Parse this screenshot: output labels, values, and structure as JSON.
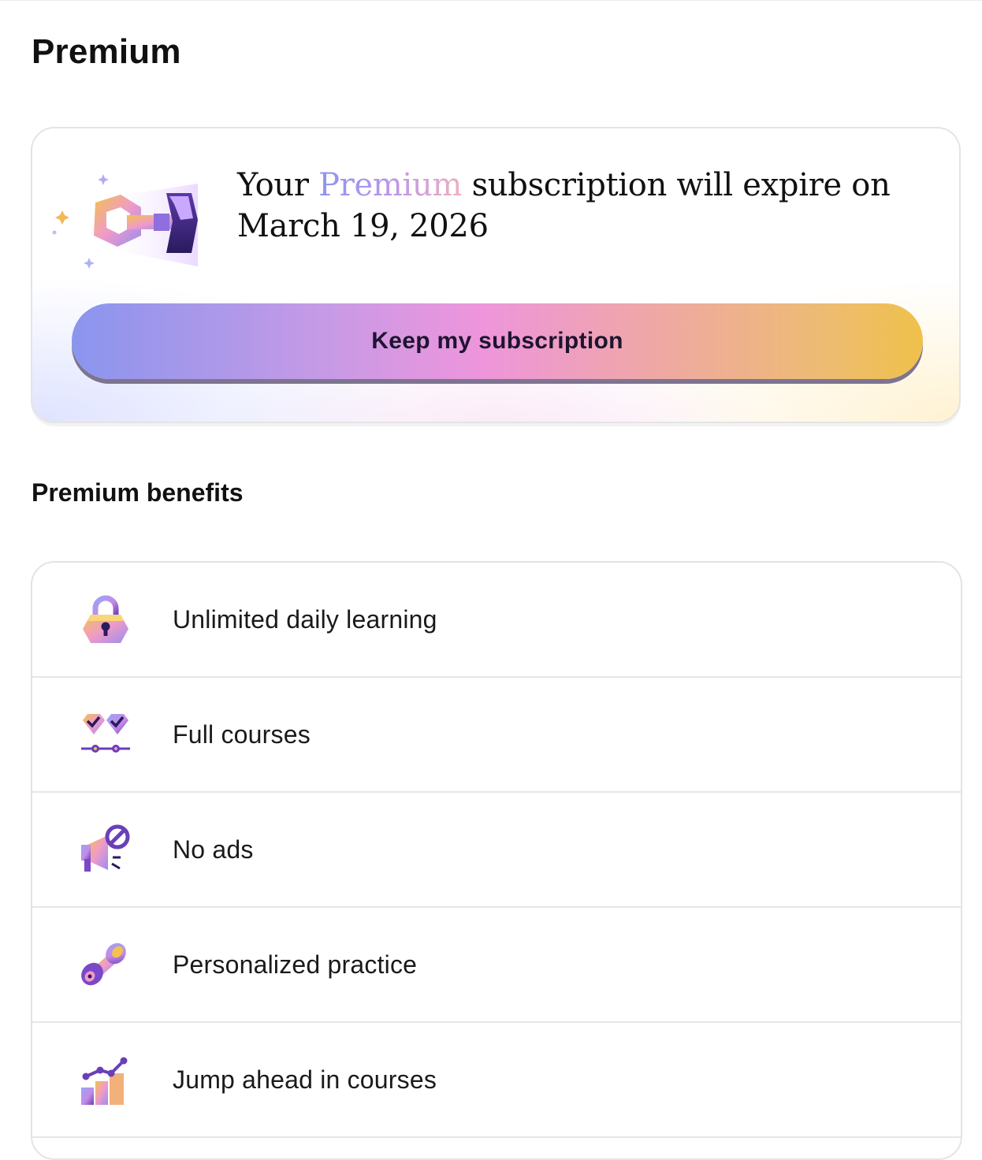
{
  "page": {
    "title": "Premium"
  },
  "subscription": {
    "message_prefix": "Your ",
    "message_highlight": "Premium",
    "message_suffix": " subscription will expire on March 19, 2026",
    "keep_button_label": "Keep my subscription",
    "art_icon": "key-icon"
  },
  "benefits": {
    "title": "Premium benefits",
    "items": [
      {
        "icon": "padlock-icon",
        "label": "Unlimited daily learning"
      },
      {
        "icon": "course-path-icon",
        "label": "Full courses"
      },
      {
        "icon": "no-ads-megaphone-icon",
        "label": "No ads"
      },
      {
        "icon": "dumbbell-icon",
        "label": "Personalized practice"
      },
      {
        "icon": "progress-chart-icon",
        "label": "Jump ahead in courses"
      }
    ]
  },
  "colors": {
    "premium_gradient": [
      "#8d95f2",
      "#b895ea",
      "#eeb1bf"
    ],
    "button_gradient": [
      "#8a95ee",
      "#c79ae6",
      "#ee95dc",
      "#efa7a6",
      "#edbb73",
      "#efc14b"
    ],
    "text": "#111111",
    "border": "#e4e4e4"
  }
}
